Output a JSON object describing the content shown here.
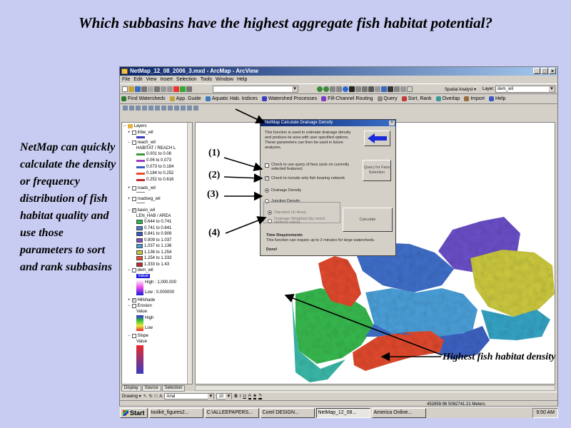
{
  "slide": {
    "title": "Which subbasins have the highest aggregate fish habitat potential?",
    "side_text": "NetMap can quickly calculate the density or frequency distribution of fish habitat quality and use those parameters to sort and rank subbasins",
    "markers": [
      "(1)",
      "(2)",
      "(3)",
      "(4)"
    ],
    "annotation": "Highest fish habitat density"
  },
  "window": {
    "title": "NetMap_12_08_2006_3.mxd - ArcMap - ArcView",
    "controls": [
      "_",
      "□",
      "×"
    ],
    "menu": [
      "File",
      "Edit",
      "View",
      "Insert",
      "Selection",
      "Tools",
      "Window",
      "Help"
    ],
    "spatial_analyst_label": "Spatial Analyst ▾",
    "layer_label": "Layer:",
    "layer_value": "dem_wil",
    "combo1_value": ""
  },
  "netmap_toolbar": [
    {
      "label": "Find Watersheds",
      "color": "#2b7a2b"
    },
    {
      "label": "App. Guide",
      "color": "#c2a23a"
    },
    {
      "label": "Aquatic Hab. Indices",
      "color": "#3a7ac2"
    },
    {
      "label": "Watershed Processes",
      "color": "#3a3ac2"
    },
    {
      "label": "Fill-Channel Routing",
      "color": "#7a3ac2"
    },
    {
      "label": "Query",
      "color": "#888888"
    },
    {
      "label": "Sort, Rank",
      "color": "#c23a3a"
    },
    {
      "label": "Overlap",
      "color": "#3a9a9a"
    },
    {
      "label": "Import",
      "color": "#9a6a3a"
    },
    {
      "label": "Help",
      "color": "#3a5ac2"
    }
  ],
  "toc": {
    "header": "Layers",
    "tribe_layer": "tribe_wil",
    "reach_layer": "reach_wil",
    "reach_field": "HABITAT / REACH L",
    "reach_ranges": [
      {
        "label": "0.001 to 0.06",
        "color": "#3a9a3a"
      },
      {
        "label": "0.06 to 0.073",
        "color": "#9a3ac2"
      },
      {
        "label": "0.073 to 0.184",
        "color": "#3a5ac2"
      },
      {
        "label": "0.184 to 0.252",
        "color": "#e84a2a"
      },
      {
        "label": "0.252 to 0.616",
        "color": "#c22a2a"
      }
    ],
    "roads_layer": "roads_wil",
    "roadseg_layer": "roadseg_wil",
    "basin_layer": "basin_wil",
    "basin_field": "LEN_HAB / AREA",
    "basin_ranges": [
      {
        "label": "0.644 to 0.741",
        "color": "#2ab84a"
      },
      {
        "label": "0.741 to 0.841",
        "color": "#4a7ac8"
      },
      {
        "label": "0.841 to 0.909",
        "color": "#3a5ac2"
      },
      {
        "label": "0.909 to 1.037",
        "color": "#7a4ac2"
      },
      {
        "label": "1.037 to 1.136",
        "color": "#4a9ad8"
      },
      {
        "label": "1.136 to 1.254",
        "color": "#c8c83a"
      },
      {
        "label": "1.254 to 1.333",
        "color": "#e84a2a"
      },
      {
        "label": "1.333 to 1.43",
        "color": "#c22a2a"
      }
    ],
    "dem_layer": "dem_wil",
    "value_label": "Value",
    "dem_high": "High : 1,000.000",
    "dem_low": "Low : 0.000000",
    "hillshade_layer": "Hillshade",
    "erosion_layer": "Erosion",
    "erosion_high": "High",
    "erosion_low": "Low",
    "slope_layer": "Slope",
    "slope_value": "Value",
    "tabs": [
      "Display",
      "Source",
      "Selection"
    ]
  },
  "dialog": {
    "title": "NetMap Calculate Drainage Density",
    "description": "This function is used to estimate drainage density and produce its area with user specified options. These parameters can then be used in future analyses.",
    "option1": "Check to use query of fans (acts on currently selected features)",
    "option2": "Check to include only fish bearing network",
    "option3": "Drainage Density",
    "option4": "Junction Density",
    "option5": "Standard (In Area)",
    "option6": "Drainage Weighted (by reach attribute value)",
    "side_button": "Query for Fans Selection",
    "calc_button": "Calculate",
    "time_heading": "Time Requirements",
    "time_text": "This function can require up to 2 minutes for large watersheds.",
    "status": "Done!"
  },
  "drawbar": {
    "drawing_label": "Drawing ▾",
    "font": "Arial",
    "font_size": "10",
    "format_buttons": [
      "B",
      "I",
      "U"
    ]
  },
  "statusbar": {
    "coordinates": "452859.96  5082741.21 Meters"
  },
  "taskbar": {
    "start": "Start",
    "tasks": [
      {
        "label": "toolkit_figures2...",
        "active": false
      },
      {
        "label": "C:\\ALLEEPAPERS...",
        "active": false
      },
      {
        "label": "Corel DESIGN...",
        "active": false
      },
      {
        "label": "NetMap_12_08...",
        "active": true
      },
      {
        "label": "America Online...",
        "active": false
      }
    ],
    "clock": "9:50 AM"
  }
}
